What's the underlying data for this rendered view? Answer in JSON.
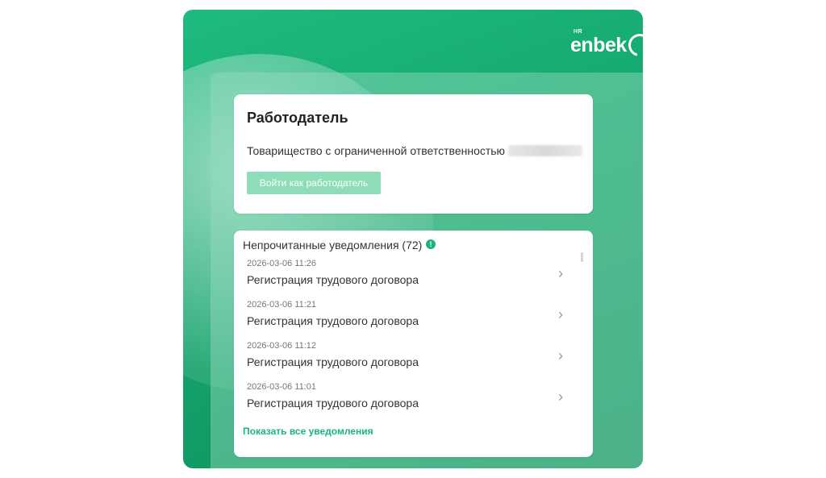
{
  "brand": {
    "hr": "HR",
    "word": "enbek"
  },
  "employer": {
    "title": "Работодатель",
    "org_prefix": "Товарищество с ограниченной ответственностью",
    "button": "Войти как работодатель"
  },
  "notifications": {
    "header": "Непрочитанные уведомления (72)",
    "badge_glyph": "!",
    "items": [
      {
        "time": "2026-03-06 11:26",
        "title": "Регистрация трудового договора"
      },
      {
        "time": "2026-03-06 11:21",
        "title": "Регистрация трудового договора"
      },
      {
        "time": "2026-03-06 11:12",
        "title": "Регистрация трудового договора"
      },
      {
        "time": "2026-03-06 11:01",
        "title": "Регистрация трудового договора"
      }
    ],
    "show_all": "Показать все уведомления"
  },
  "colors": {
    "primary": "#1ab57a",
    "button_disabled": "#8fdcb9"
  },
  "icons": {
    "chevron": "chevron-right-icon",
    "alert": "exclamation-icon"
  }
}
